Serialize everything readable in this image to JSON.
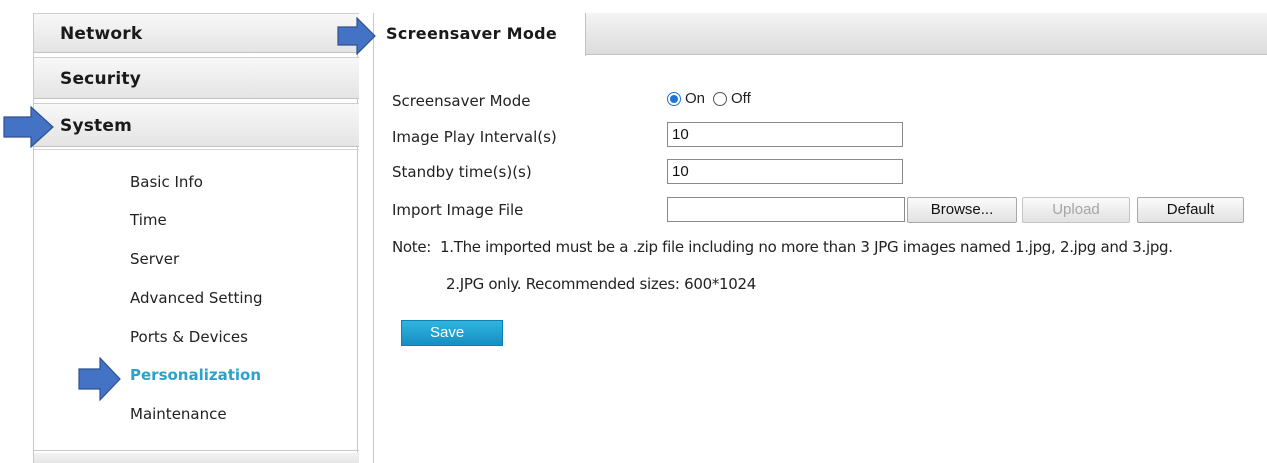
{
  "sidebar": {
    "sections": [
      {
        "label": "Network"
      },
      {
        "label": "Security"
      },
      {
        "label": "System"
      }
    ],
    "submenu": [
      {
        "label": "Basic Info"
      },
      {
        "label": "Time"
      },
      {
        "label": "Server"
      },
      {
        "label": "Advanced Setting"
      },
      {
        "label": "Ports & Devices"
      },
      {
        "label": "Personalization",
        "active": true
      },
      {
        "label": "Maintenance"
      }
    ]
  },
  "tab": {
    "label": "Screensaver Mode"
  },
  "form": {
    "screensaver_mode": {
      "label": "Screensaver Mode",
      "options": [
        "On",
        "Off"
      ],
      "selected": "On"
    },
    "image_play_interval": {
      "label": "Image Play Interval(s)",
      "value": "10"
    },
    "standby_time": {
      "label": "Standby time(s)(s)",
      "value": "10"
    },
    "import_image": {
      "label": "Import Image File",
      "value": ""
    },
    "buttons": {
      "browse": "Browse...",
      "upload": "Upload",
      "default": "Default",
      "save": "Save"
    },
    "note": {
      "prefix": "Note:",
      "line1": "1.The imported must be a .zip file including no more than 3 JPG images named 1.jpg, 2.jpg and 3.jpg.",
      "line2": "2.JPG only. Recommended sizes: 600*1024"
    }
  },
  "colors": {
    "accent": "#2aa3c9",
    "save_button": "#1fa3d4",
    "arrow": "#4472c4",
    "radio_selected": "#1e74d6"
  }
}
